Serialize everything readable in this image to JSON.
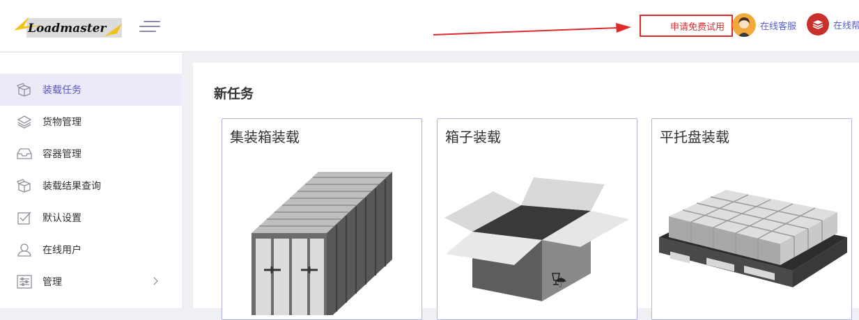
{
  "header": {
    "logo_text": "Loadmaster",
    "trial_button": "申请免费试用",
    "service_label": "在线客服",
    "help_label": "在线帮"
  },
  "sidebar": {
    "items": [
      {
        "label": "装载任务",
        "icon": "box-open-icon",
        "active": true
      },
      {
        "label": "货物管理",
        "icon": "layers-icon",
        "active": false
      },
      {
        "label": "容器管理",
        "icon": "inbox-icon",
        "active": false
      },
      {
        "label": "装载结果查询",
        "icon": "box-search-icon",
        "active": false
      },
      {
        "label": "默认设置",
        "icon": "checkbox-icon",
        "active": false
      },
      {
        "label": "在线用户",
        "icon": "user-icon",
        "active": false
      },
      {
        "label": "管理",
        "icon": "sliders-icon",
        "active": false
      }
    ]
  },
  "main": {
    "section_title": "新任务",
    "cards": [
      {
        "title": "集装箱装载",
        "image": "shipping-container"
      },
      {
        "title": "箱子装载",
        "image": "cardboard-box"
      },
      {
        "title": "平托盘装载",
        "image": "pallet"
      }
    ]
  },
  "colors": {
    "accent": "#5a55c6",
    "active_bg": "#eceaf9",
    "trial_red": "#e02a2a",
    "card_border": "#b4b0e6"
  }
}
